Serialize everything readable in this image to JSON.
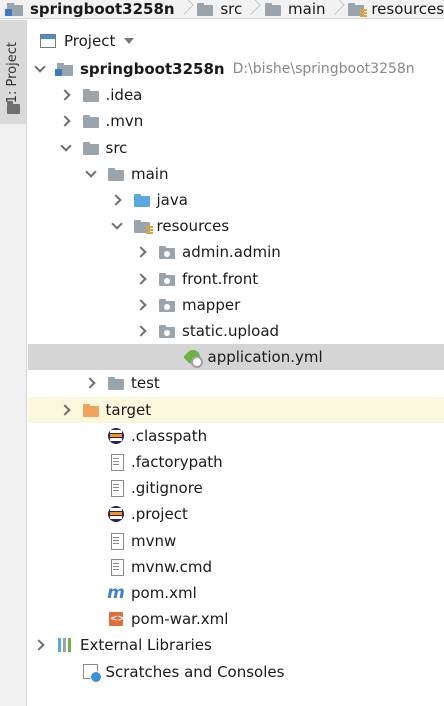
{
  "breadcrumb": [
    {
      "label": "springboot3258n",
      "icon": "module-icon"
    },
    {
      "label": "src",
      "icon": "folder-icon"
    },
    {
      "label": "main",
      "icon": "folder-icon"
    },
    {
      "label": "resources",
      "icon": "resources-folder-icon"
    }
  ],
  "tool_stripe": {
    "project_tab_label": "1: Project"
  },
  "panel": {
    "title": "Project",
    "dropdown_icon": "chevron-down-icon"
  },
  "tree": [
    {
      "label": "springboot3258n",
      "path": "D:\\bishe\\springboot3258n",
      "depth": 0,
      "expand": "down",
      "icon": "module"
    },
    {
      "label": ".idea",
      "depth": 1,
      "expand": "right",
      "icon": "folder"
    },
    {
      "label": ".mvn",
      "depth": 1,
      "expand": "right",
      "icon": "folder"
    },
    {
      "label": "src",
      "depth": 1,
      "expand": "down",
      "icon": "folder"
    },
    {
      "label": "main",
      "depth": 2,
      "expand": "down",
      "icon": "folder"
    },
    {
      "label": "java",
      "depth": 3,
      "expand": "right",
      "icon": "folder-blue"
    },
    {
      "label": "resources",
      "depth": 3,
      "expand": "down",
      "icon": "folder-res"
    },
    {
      "label": "admin.admin",
      "depth": 4,
      "expand": "right",
      "icon": "folder-pkg"
    },
    {
      "label": "front.front",
      "depth": 4,
      "expand": "right",
      "icon": "folder-pkg"
    },
    {
      "label": "mapper",
      "depth": 4,
      "expand": "right",
      "icon": "folder-pkg"
    },
    {
      "label": "static.upload",
      "depth": 4,
      "expand": "right",
      "icon": "folder-pkg"
    },
    {
      "label": "application.yml",
      "depth": 5,
      "expand": "none",
      "icon": "spring",
      "state": "selected"
    },
    {
      "label": "test",
      "depth": 2,
      "expand": "right",
      "icon": "folder"
    },
    {
      "label": "target",
      "depth": 1,
      "expand": "right",
      "icon": "folder-orange",
      "state": "highlighted"
    },
    {
      "label": ".classpath",
      "depth": 2,
      "expand": "none",
      "icon": "eclipse"
    },
    {
      "label": ".factorypath",
      "depth": 2,
      "expand": "none",
      "icon": "file"
    },
    {
      "label": ".gitignore",
      "depth": 2,
      "expand": "none",
      "icon": "file"
    },
    {
      "label": ".project",
      "depth": 2,
      "expand": "none",
      "icon": "eclipse"
    },
    {
      "label": "mvnw",
      "depth": 2,
      "expand": "none",
      "icon": "file"
    },
    {
      "label": "mvnw.cmd",
      "depth": 2,
      "expand": "none",
      "icon": "file"
    },
    {
      "label": "pom.xml",
      "depth": 2,
      "expand": "none",
      "icon": "maven"
    },
    {
      "label": "pom-war.xml",
      "depth": 2,
      "expand": "none",
      "icon": "xml"
    },
    {
      "label": "External Libraries",
      "depth": 0,
      "expand": "right",
      "icon": "lib"
    },
    {
      "label": "Scratches and Consoles",
      "depth": 1,
      "expand": "none",
      "icon": "scratch"
    }
  ],
  "colors": {
    "selected_row": "#d5d5d5",
    "highlight_row": "#fbf7dd",
    "folder_gray": "#9aa4ad",
    "folder_blue": "#5ba8e0",
    "folder_orange": "#f0a35a"
  }
}
